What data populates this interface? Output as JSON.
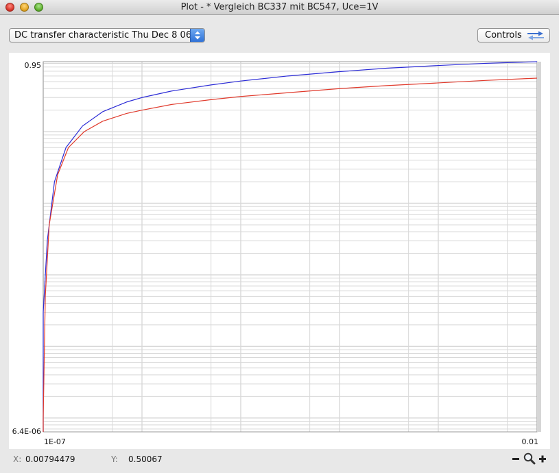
{
  "window": {
    "title": "Plot - * Vergleich BC337 mit BC547, Uce=1V"
  },
  "toolbar": {
    "select_value": "DC transfer characteristic  Thu Dec  8 06",
    "controls_label": "Controls"
  },
  "status": {
    "x_label": "X:",
    "x_value": "0.00794479",
    "y_label": "Y:",
    "y_value": "0.50067"
  },
  "colors": {
    "series_blue": "#2b2bd6",
    "series_red": "#e0392b",
    "grid": "#d8d8d8",
    "plot_bg": "#ffffff"
  },
  "icons": {
    "controls": "swap-arrows-icon",
    "zoom_out": "minus-icon",
    "zoom": "magnifier-icon",
    "zoom_in": "plus-icon"
  },
  "chart_data": {
    "type": "line",
    "title": "",
    "xlabel": "",
    "ylabel": "",
    "x_scale": "log",
    "y_scale": "log",
    "xlim": [
      1e-07,
      0.01
    ],
    "ylim": [
      6.4e-06,
      0.95
    ],
    "x_tick_labels": [
      "1E-07",
      "0.01"
    ],
    "y_tick_labels": [
      "0.95",
      "6.4E-06"
    ],
    "grid": true,
    "legend": "none",
    "series": [
      {
        "color": "#2b2bd6",
        "x": [
          1e-07,
          1.1e-07,
          1.3e-07,
          1.7e-07,
          2.5e-07,
          4e-07,
          7e-07,
          1e-06,
          2e-06,
          5e-06,
          1e-05,
          3e-05,
          0.0001,
          0.0003,
          0.001,
          0.003,
          0.01
        ],
        "y": [
          0.0003,
          0.003,
          0.02,
          0.06,
          0.12,
          0.19,
          0.26,
          0.3,
          0.37,
          0.45,
          0.51,
          0.6,
          0.69,
          0.77,
          0.84,
          0.9,
          0.95
        ]
      },
      {
        "color": "#e0392b",
        "x": [
          1e-07,
          1.05e-07,
          1.15e-07,
          1.4e-07,
          1.8e-07,
          2.6e-07,
          4e-07,
          7e-07,
          1e-06,
          2e-06,
          5e-06,
          1e-05,
          3e-05,
          0.0001,
          0.0003,
          0.001,
          0.003,
          0.01
        ],
        "y": [
          1e-05,
          0.0005,
          0.005,
          0.025,
          0.06,
          0.1,
          0.14,
          0.18,
          0.2,
          0.24,
          0.28,
          0.31,
          0.35,
          0.4,
          0.44,
          0.48,
          0.52,
          0.56
        ]
      }
    ]
  }
}
